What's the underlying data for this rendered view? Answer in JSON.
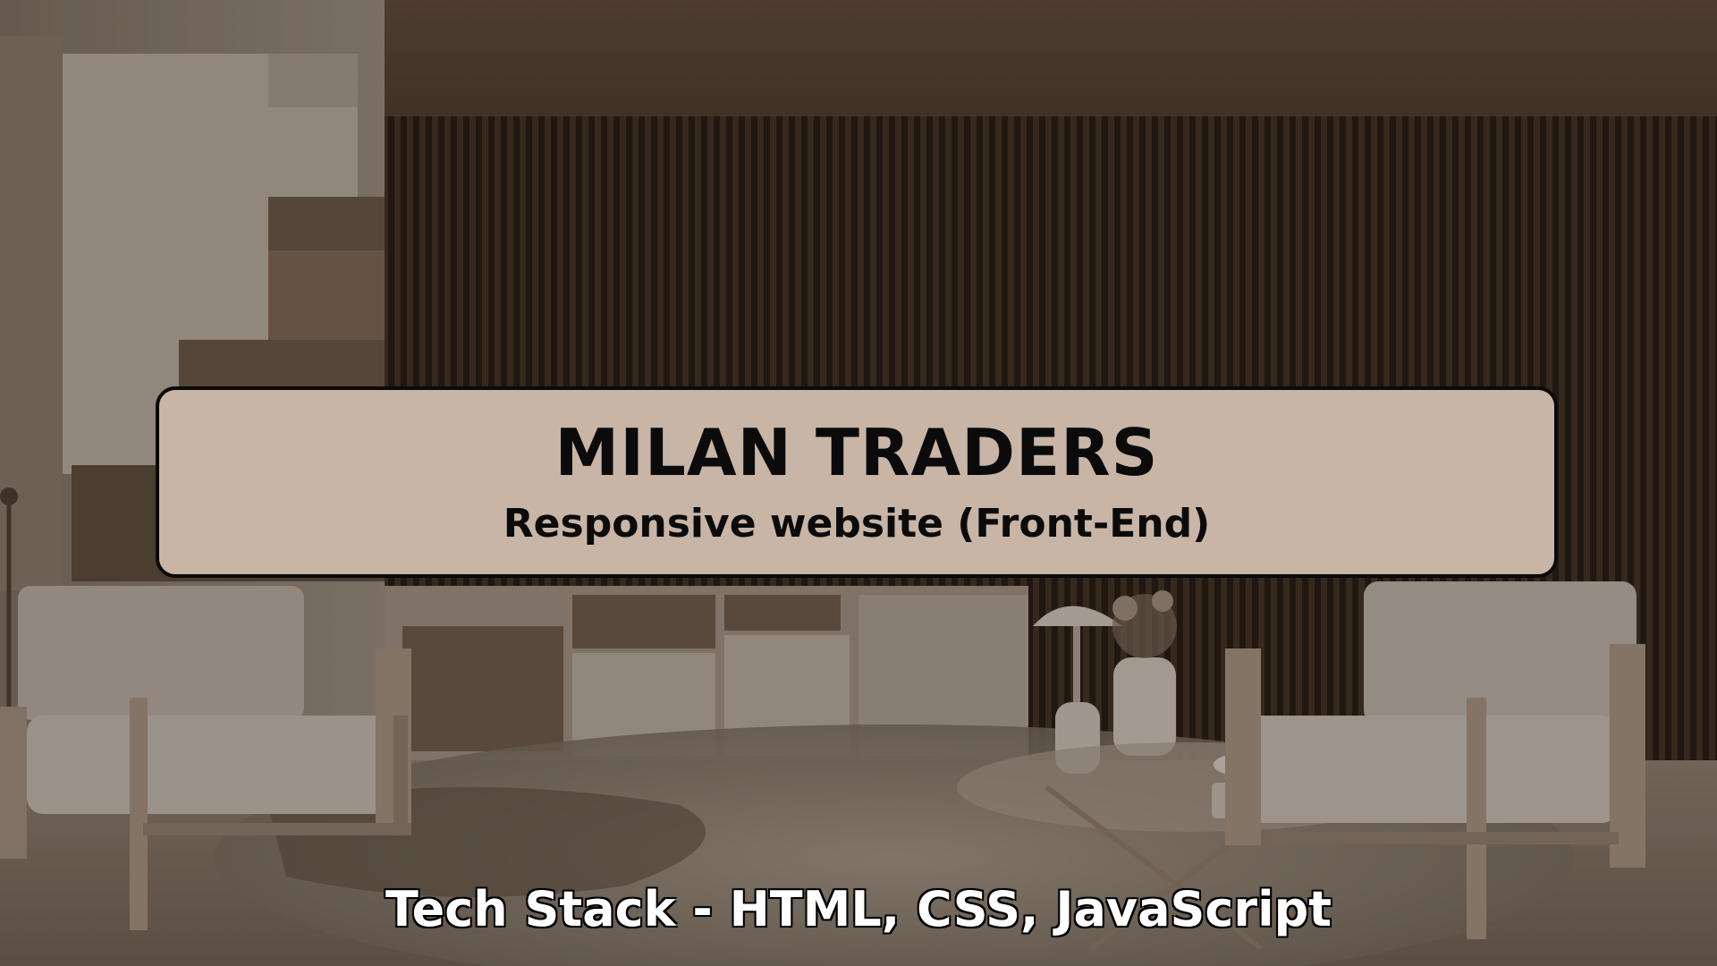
{
  "banner": {
    "title": "MILAN TRADERS",
    "subtitle": "Responsive website (Front-End)",
    "tech_stack": "Tech Stack - HTML, CSS, JavaScript"
  },
  "colors": {
    "card_background": "#c8b5a6",
    "card_border": "#0a0a0a",
    "text_dark": "#0b0b0b",
    "text_light": "#ffffff"
  }
}
